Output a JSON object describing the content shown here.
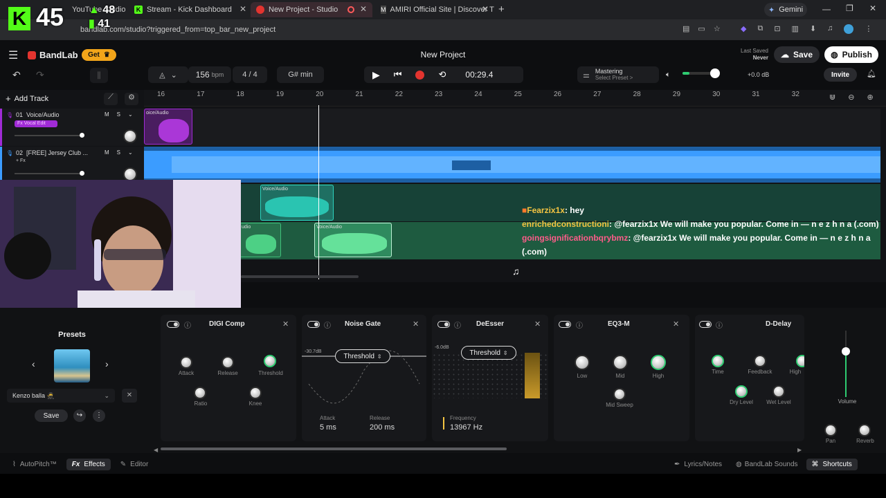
{
  "overlay": {
    "big_number": "45",
    "count_top": "48",
    "count_bottom": "41"
  },
  "browser": {
    "tabs": [
      {
        "label": "YouTube Studio"
      },
      {
        "label": "Stream - Kick Dashboard"
      },
      {
        "label": "New Project - Studio"
      },
      {
        "label": "AMIRI Official Site | Discover Th"
      }
    ],
    "gemini_label": "Gemini",
    "url": "bandlab.com/studio?triggered_from=top_bar_new_project"
  },
  "header": {
    "brand": "BandLab",
    "get_label": "Get",
    "project_title": "New Project",
    "last_saved_label": "Last Saved",
    "last_saved_value": "Never",
    "save_label": "Save",
    "publish_label": "Publish"
  },
  "transport": {
    "bpm_value": "156",
    "bpm_unit": "bpm",
    "time_signature": "4 / 4",
    "key": "G# min",
    "time": "00:29.4",
    "mastering_label": "Mastering",
    "mastering_preset": "Select Preset >",
    "master_db": "+0.0 dB",
    "invite_label": "Invite"
  },
  "tracks_panel": {
    "add_track_label": "Add Track",
    "ruler": [
      "16",
      "17",
      "18",
      "19",
      "20",
      "21",
      "22",
      "23",
      "24",
      "25",
      "26",
      "27",
      "28",
      "29",
      "30",
      "31",
      "32"
    ],
    "tracks": [
      {
        "number": "01",
        "name": "Voice/Audio",
        "badge": "Fx Vocal Edit",
        "mute": "M",
        "solo": "S"
      },
      {
        "number": "02",
        "name": "[FREE] Jersey Club ...",
        "badge": "+ Fx",
        "mute": "M",
        "solo": "S"
      }
    ],
    "clip_label": "Voice/Audio",
    "clip_label_partial": "oice/Audio",
    "clip_label_short": "udio"
  },
  "chat": [
    {
      "user": "Fearzix1x",
      "message": ": hey",
      "color": "#f5c542"
    },
    {
      "user": "enrichedconstructioni",
      "message": ": @fearzix1x We will make you popular. Come in — n e z h n a (.com)",
      "color": "#f5c542"
    },
    {
      "user": "goingsignificationbqrybmz",
      "message": ": @fearzix1x We will make you popular. Come in — n e z h n a (.com)",
      "color": "#ff5c8a"
    }
  ],
  "presets": {
    "title": "Presets",
    "name": "Kenzo balla 🥷",
    "save_label": "Save"
  },
  "effects": [
    {
      "name": "DIGI Comp",
      "knobs": [
        "Attack",
        "Release",
        "Threshold",
        "Ratio",
        "Knee"
      ]
    },
    {
      "name": "Noise Gate",
      "control": "Threshold",
      "db": "-30.7dB",
      "attack_label": "Attack",
      "attack_value": "5 ms",
      "release_label": "Release",
      "release_value": "200 ms"
    },
    {
      "name": "DeEsser",
      "control": "Threshold",
      "db": "-6.0dB",
      "freq_label": "Frequency",
      "freq_value": "13967 Hz"
    },
    {
      "name": "EQ3-M",
      "knobs": [
        "Low",
        "Mid",
        "High",
        "Mid Sweep"
      ]
    },
    {
      "name": "D-Delay",
      "knobs": [
        "Time",
        "Feedback",
        "High",
        "Dry Level",
        "Wet Level"
      ]
    }
  ],
  "channel": {
    "volume_label": "Volume",
    "pan_label": "Pan",
    "reverb_label": "Reverb"
  },
  "bottom": {
    "autopitch": "AutoPitch™",
    "effects": "Effects",
    "editor": "Editor",
    "lyrics": "Lyrics/Notes",
    "sounds": "BandLab Sounds",
    "shortcuts": "Shortcuts"
  },
  "colors": {
    "accent_red": "#e3342f",
    "track_blue": "#3b9cff",
    "track_purple": "#a02bd6",
    "clip_teal": "#2dd4bf",
    "kick_green": "#53fc18"
  }
}
